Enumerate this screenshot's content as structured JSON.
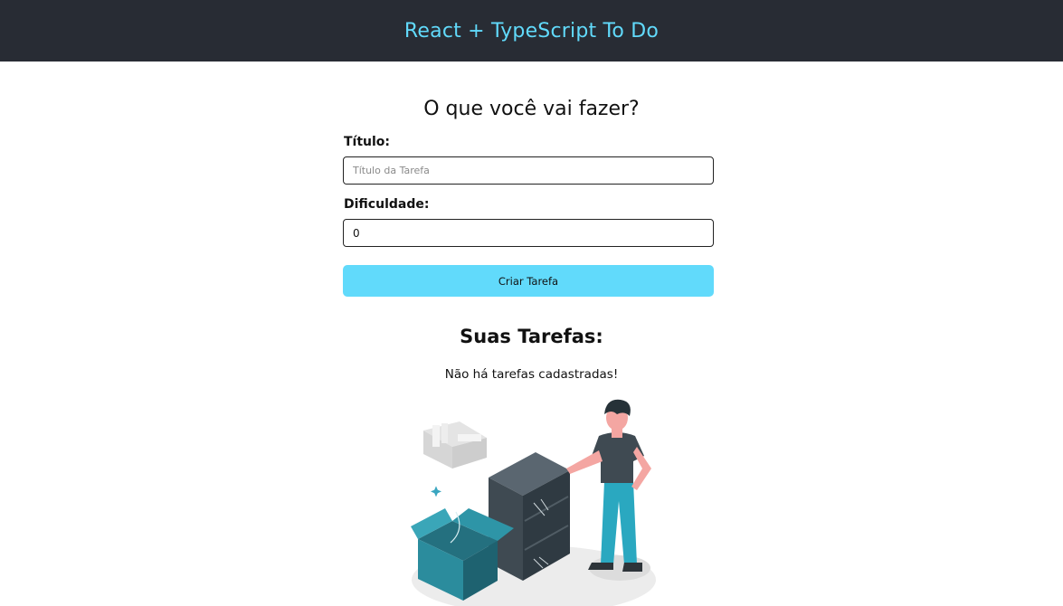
{
  "header": {
    "title": "React + TypeScript To Do"
  },
  "form": {
    "heading": "O que você vai fazer?",
    "title_label": "Título:",
    "title_placeholder": "Título da Tarefa",
    "title_value": "",
    "difficulty_label": "Dificuldade:",
    "difficulty_value": "0",
    "submit_label": "Criar Tarefa"
  },
  "tasks": {
    "heading": "Suas Tarefas:",
    "empty_message": "Não há tarefas cadastradas!",
    "illustration_icon": "empty-tasks-illustration"
  },
  "colors": {
    "header_bg": "#282c34",
    "accent": "#61dafb",
    "text": "#111111"
  }
}
